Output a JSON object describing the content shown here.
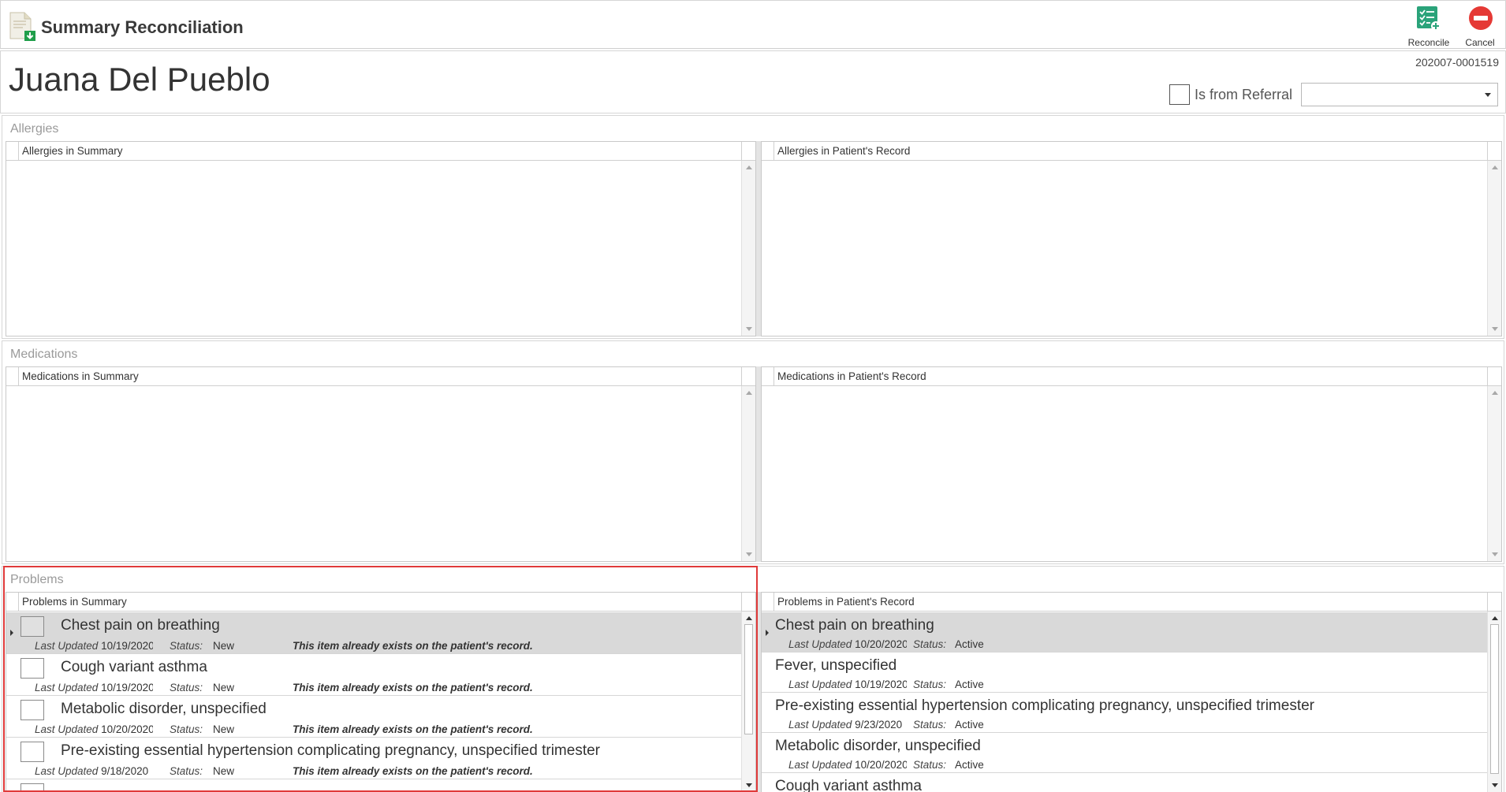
{
  "app": {
    "title": "Summary Reconciliation"
  },
  "toolbar": {
    "reconcile_label": "Reconcile",
    "cancel_label": "Cancel"
  },
  "patient": {
    "name": "Juana Del Pueblo",
    "doc_id": "202007-0001519",
    "referral_label": "Is from Referral",
    "referral_selected": "",
    "referral_checked": false
  },
  "sections": {
    "allergies": {
      "title": "Allergies",
      "summary_header": "Allergies in Summary",
      "record_header": "Allergies in Patient's Record"
    },
    "medications": {
      "title": "Medications",
      "summary_header": "Medications in Summary",
      "record_header": "Medications in Patient's Record"
    },
    "problems": {
      "title": "Problems",
      "summary_header": "Problems in Summary",
      "record_header": "Problems in Patient's Record",
      "last_updated_label": "Last Updated",
      "status_label": "Status:",
      "summary_items": [
        {
          "name": "Chest pain on breathing",
          "last_updated": "10/19/2020",
          "status": "New",
          "note": "This item already exists on the patient's record."
        },
        {
          "name": "Cough variant asthma",
          "last_updated": "10/19/2020",
          "status": "New",
          "note": "This item already exists on the patient's record."
        },
        {
          "name": "Metabolic disorder, unspecified",
          "last_updated": "10/20/2020",
          "status": "New",
          "note": "This item already exists on the patient's record."
        },
        {
          "name": "Pre-existing essential hypertension complicating pregnancy, unspecified trimester",
          "last_updated": "9/18/2020",
          "status": "New",
          "note": "This item already exists on the patient's record."
        }
      ],
      "record_items": [
        {
          "name": "Chest pain on breathing",
          "last_updated": "10/20/2020",
          "status": "Active"
        },
        {
          "name": "Fever, unspecified",
          "last_updated": "10/19/2020",
          "status": "Active"
        },
        {
          "name": "Pre-existing essential hypertension complicating pregnancy, unspecified trimester",
          "last_updated": "9/23/2020",
          "status": "Active"
        },
        {
          "name": "Metabolic disorder, unspecified",
          "last_updated": "10/20/2020",
          "status": "Active"
        },
        {
          "name": "Cough variant asthma",
          "last_updated": "",
          "status": ""
        }
      ]
    }
  },
  "colors": {
    "accent_highlight": "#e03a3a",
    "reconcile_icon": "#2aa37a",
    "cancel_icon": "#e53935",
    "selected_row": "#d9d9d9"
  },
  "icons": {
    "app": "document-import-icon",
    "reconcile": "checklist-add-icon",
    "cancel": "no-entry-icon"
  }
}
